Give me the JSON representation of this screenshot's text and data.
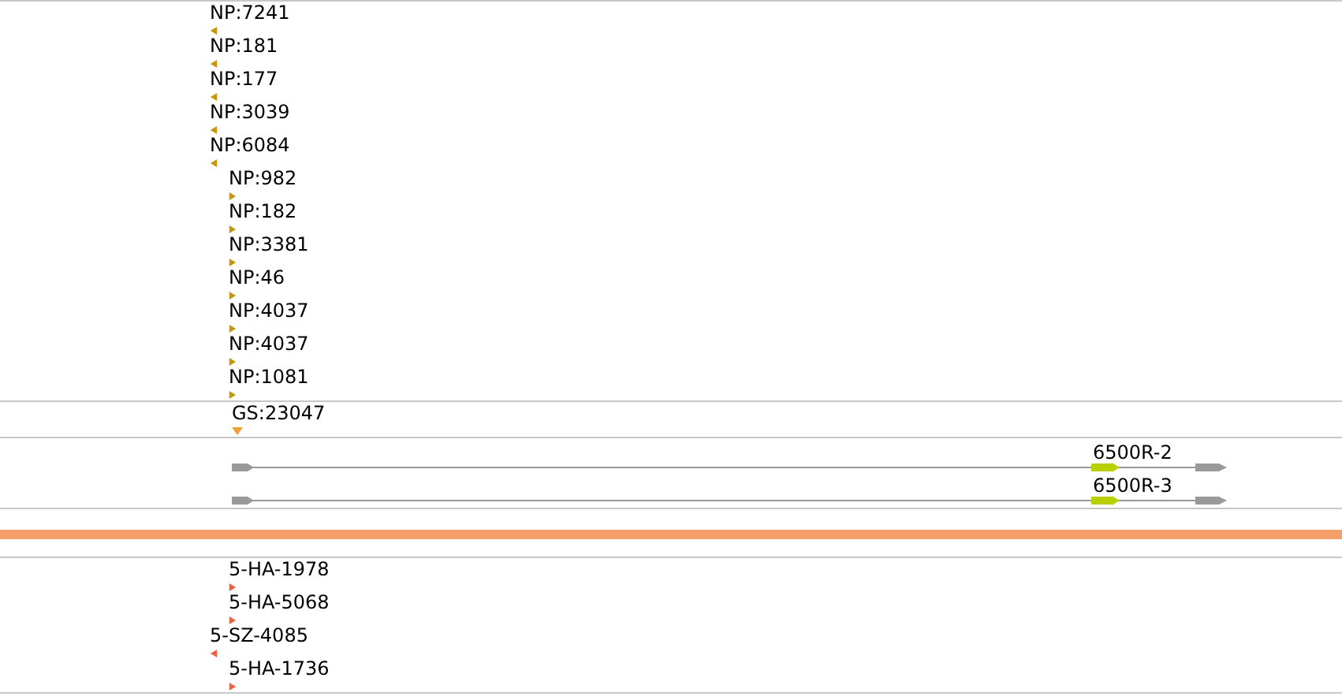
{
  "tracks": [
    {
      "kind": "features",
      "color": "#c8960a",
      "features": [
        {
          "label": "NP:7241",
          "kind": "reverse"
        },
        {
          "label": "NP:181",
          "kind": "reverse"
        },
        {
          "label": "NP:177",
          "kind": "reverse"
        },
        {
          "label": "NP:3039",
          "kind": "reverse"
        },
        {
          "label": "NP:6084",
          "kind": "reverse"
        },
        {
          "label": "NP:982",
          "kind": "forward"
        },
        {
          "label": "NP:182",
          "kind": "forward"
        },
        {
          "label": "NP:3381",
          "kind": "forward"
        },
        {
          "label": "NP:46",
          "kind": "forward"
        },
        {
          "label": "NP:4037",
          "kind": "forward"
        },
        {
          "label": "NP:4037",
          "kind": "forward"
        },
        {
          "label": "NP:1081",
          "kind": "forward"
        }
      ]
    },
    {
      "kind": "features",
      "color": "#f0a030",
      "features": [
        {
          "label": "GS:23047",
          "kind": "point"
        }
      ]
    },
    {
      "kind": "transcripts",
      "transcripts": [
        {
          "label": "6500R-2"
        },
        {
          "label": "6500R-3"
        }
      ]
    },
    {
      "kind": "highlight",
      "color": "#f5a06a"
    },
    {
      "kind": "features",
      "color": "#f06040",
      "features": [
        {
          "label": "5-HA-1978",
          "kind": "forward"
        },
        {
          "label": "5-HA-5068",
          "kind": "forward"
        },
        {
          "label": "5-SZ-4085",
          "kind": "reverse"
        },
        {
          "label": "5-HA-1736",
          "kind": "forward"
        }
      ]
    }
  ]
}
